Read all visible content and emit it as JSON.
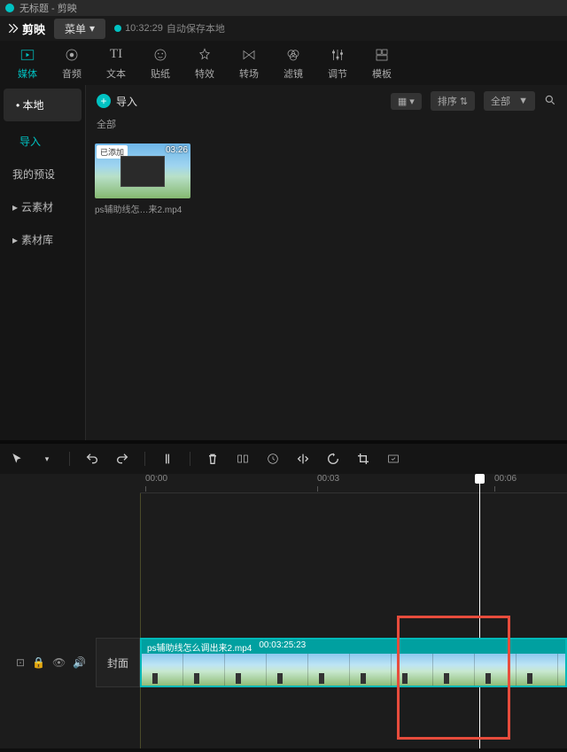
{
  "titlebar": {
    "text": "无标题 - 剪映"
  },
  "app": {
    "name": "剪映"
  },
  "menubar": {
    "menu_label": "菜单"
  },
  "save_status": {
    "time": "10:32:29",
    "text": "自动保存本地"
  },
  "tabs": [
    {
      "label": "媒体",
      "active": true
    },
    {
      "label": "音频"
    },
    {
      "label": "文本"
    },
    {
      "label": "贴纸"
    },
    {
      "label": "特效"
    },
    {
      "label": "转场"
    },
    {
      "label": "滤镜"
    },
    {
      "label": "调节"
    },
    {
      "label": "模板"
    }
  ],
  "sidebar": {
    "groups": [
      {
        "label": "本地",
        "type": "group"
      },
      {
        "label": "导入",
        "type": "sub"
      },
      {
        "label": "我的预设",
        "type": "item"
      },
      {
        "label": "云素材",
        "type": "exp"
      },
      {
        "label": "素材库",
        "type": "exp"
      }
    ]
  },
  "content": {
    "import_label": "导入",
    "filter_all": "全部",
    "sort_label": "排序",
    "all_label": "全部",
    "media": {
      "badge": "已添加",
      "duration": "03:26",
      "name": "ps辅助线怎…来2.mp4"
    }
  },
  "timeline": {
    "ticks": [
      "00:00",
      "00:03",
      "00:06"
    ],
    "cover_label": "封面",
    "clip": {
      "name": "ps辅助线怎么调出来2.mp4",
      "duration": "00:03:25:23"
    }
  }
}
